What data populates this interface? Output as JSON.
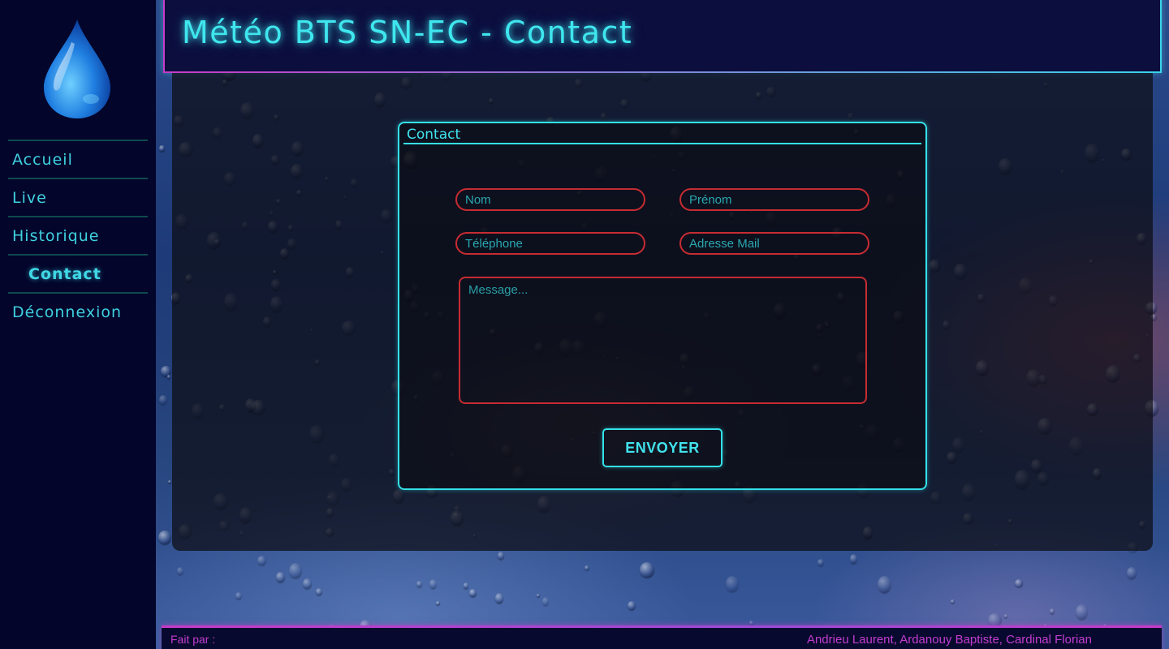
{
  "header": {
    "title": "Météo BTS SN-EC - Contact"
  },
  "sidebar": {
    "logo_icon": "water-drop-icon",
    "items": [
      {
        "label": "Accueil",
        "active": false
      },
      {
        "label": "Live",
        "active": false
      },
      {
        "label": "Historique",
        "active": false
      },
      {
        "label": "Contact",
        "active": true
      },
      {
        "label": "Déconnexion",
        "active": false
      }
    ]
  },
  "contact_form": {
    "title": "Contact",
    "fields": {
      "nom": {
        "placeholder": "Nom",
        "value": ""
      },
      "prenom": {
        "placeholder": "Prénom",
        "value": ""
      },
      "telephone": {
        "placeholder": "Téléphone",
        "value": ""
      },
      "email": {
        "placeholder": "Adresse Mail",
        "value": ""
      },
      "message": {
        "placeholder": "Message...",
        "value": ""
      }
    },
    "submit_label": "ENVOYER"
  },
  "footer": {
    "left_text": "Fait par :",
    "authors": "Andrieu Laurent, Ardanouy Baptiste, Cardinal Florian"
  },
  "colors": {
    "accent_cyan": "#34e0e8",
    "accent_magenta": "#c43ccf",
    "field_border_red": "#c62c32",
    "sidebar_bg": "#03052b"
  }
}
